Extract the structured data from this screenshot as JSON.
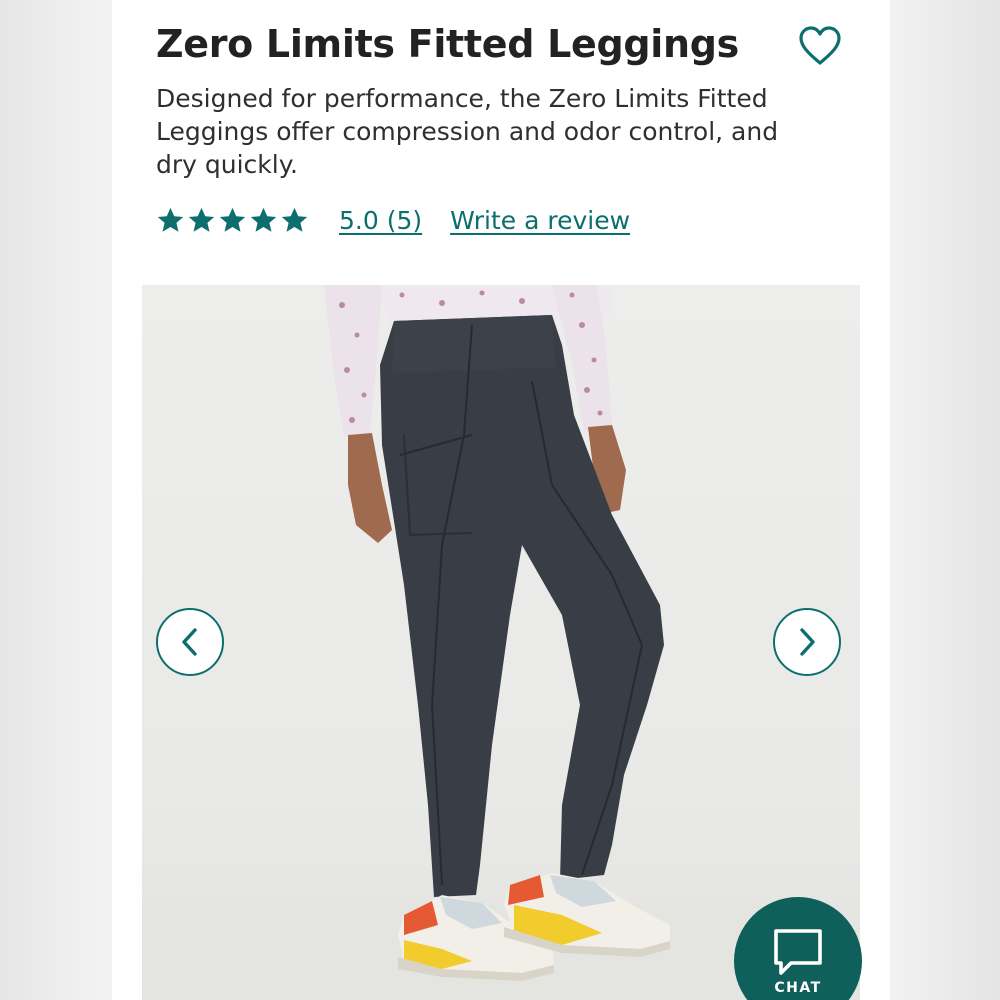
{
  "product": {
    "title": "Zero Limits Fitted Leggings",
    "description": "Designed for performance, the Zero Limits Fitted Leggings offer compression and odor control, and dry quickly.",
    "favorite_icon": "heart-outline-icon"
  },
  "rating": {
    "stars": 5,
    "max_stars": 5,
    "summary_link": "5.0 (5)",
    "write_review_link": "Write a review"
  },
  "gallery": {
    "image": "woman-wearing-black-leggings-and-sneakers",
    "prev_icon": "chevron-left-icon",
    "next_icon": "chevron-right-icon"
  },
  "chat": {
    "label": "CHAT",
    "icon": "chat-bubble-icon"
  },
  "colors": {
    "accent": "#0d6e6e",
    "chat_bg": "#0f5f5a",
    "title": "#222222",
    "body_text": "#2f2f2f"
  }
}
